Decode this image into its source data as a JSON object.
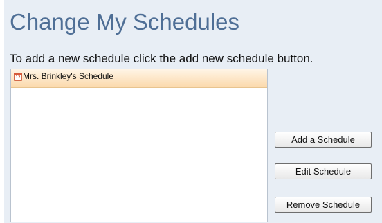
{
  "page": {
    "title": "Change My Schedules",
    "instructions": "To add a new schedule click the add new schedule button."
  },
  "schedules": {
    "items": [
      {
        "label": "Mrs. Brinkley's Schedule",
        "icon": "calendar-icon",
        "icon_text": "12",
        "selected": true
      }
    ]
  },
  "buttons": {
    "add": "Add a Schedule",
    "edit": "Edit Schedule",
    "remove": "Remove Schedule"
  },
  "colors": {
    "title": "#4f6f96",
    "selected_row": "#fbd9ac",
    "page_background": "#e8eef5",
    "calendar_accent": "#d65a3a"
  }
}
